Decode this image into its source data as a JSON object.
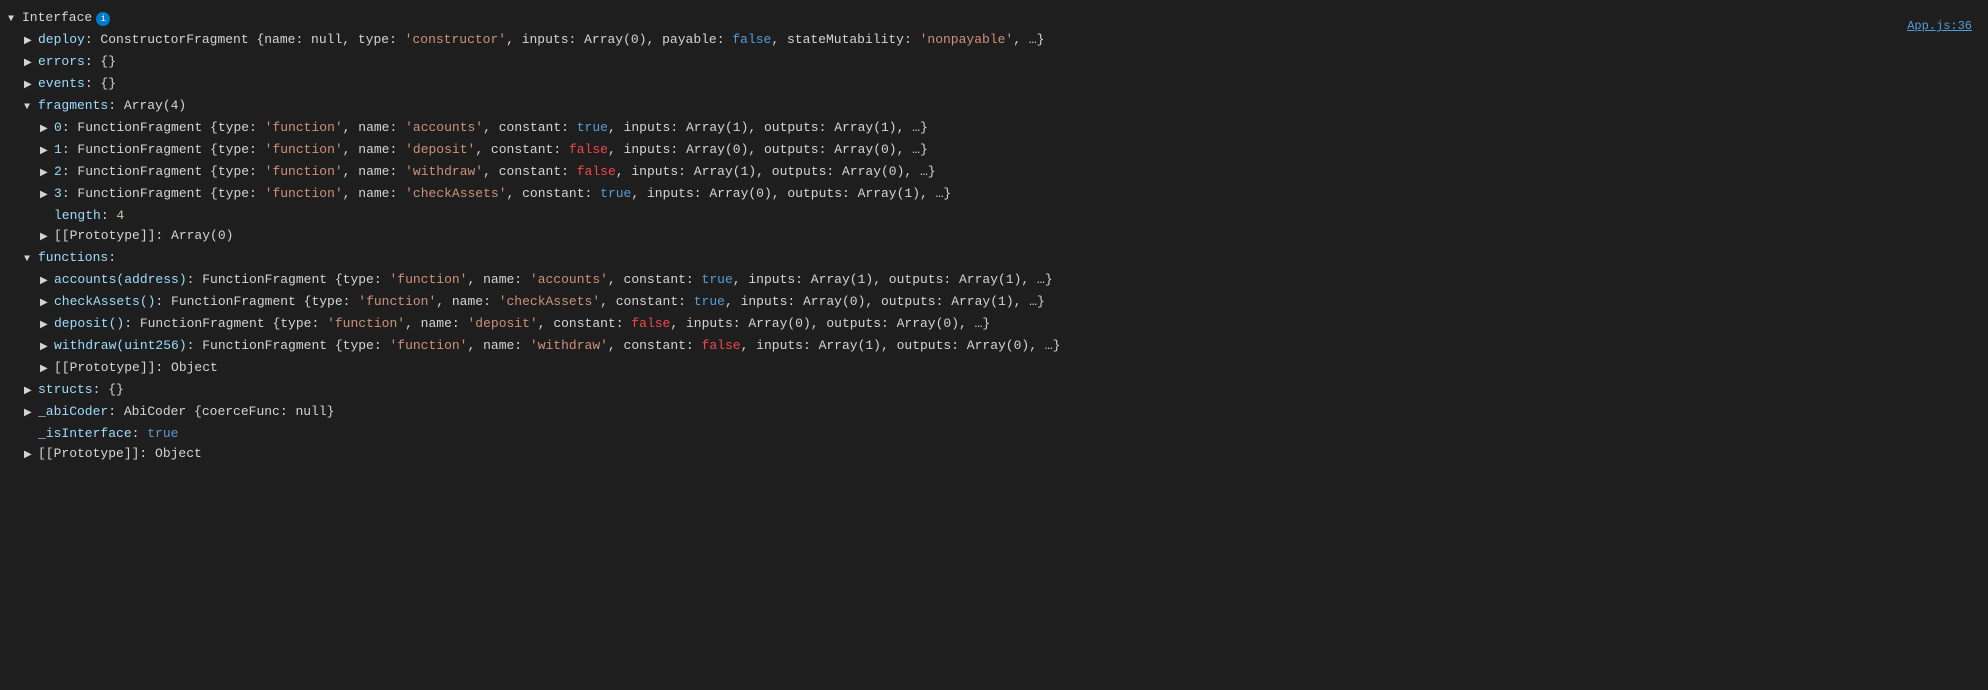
{
  "file_ref": "App.js:36",
  "root": {
    "label": "Interface",
    "badge": "i",
    "expanded": true
  },
  "lines": [
    {
      "indent": 1,
      "type": "collapsed",
      "key": "deploy",
      "value": "ConstructorFragment {name: null, type: ",
      "string1": "'constructor'",
      "value2": ", inputs: Array(0), payable: ",
      "bool1": "false",
      "value3": ", stateMutability: ",
      "string2": "'nonpayable'",
      "value4": ", …}"
    },
    {
      "indent": 1,
      "type": "collapsed",
      "key": "errors",
      "value": "{}"
    },
    {
      "indent": 1,
      "type": "collapsed",
      "key": "events",
      "value": "{}"
    },
    {
      "indent": 1,
      "type": "section-expanded",
      "key": "fragments",
      "value": "Array(4)"
    },
    {
      "indent": 2,
      "type": "collapsed-item",
      "key": "0",
      "value": "FunctionFragment {type: ",
      "string1": "'function'",
      "v2": ", name: ",
      "string2": "'accounts'",
      "v3": ", constant: ",
      "bool1": "true",
      "v4": ", inputs: Array(1), outputs: Array(1), …}"
    },
    {
      "indent": 2,
      "type": "collapsed-item",
      "key": "1",
      "value": "FunctionFragment {type: ",
      "string1": "'function'",
      "v2": ", name: ",
      "string2": "'deposit'",
      "v3": ", constant: ",
      "bool1": "false",
      "v4": ", inputs: Array(0), outputs: Array(0), …}"
    },
    {
      "indent": 2,
      "type": "collapsed-item",
      "key": "2",
      "value": "FunctionFragment {type: ",
      "string1": "'function'",
      "v2": ", name: ",
      "string2": "'withdraw'",
      "v3": ", constant: ",
      "bool1": "false",
      "v4": ", inputs: Array(1), outputs: Array(0), …}"
    },
    {
      "indent": 2,
      "type": "collapsed-item",
      "key": "3",
      "value": "FunctionFragment {type: ",
      "string1": "'function'",
      "v2": ", name: ",
      "string2": "'checkAssets'",
      "v3": ", constant: ",
      "bool1": "true",
      "v4": ", inputs: Array(0), outputs: Array(1), …}"
    },
    {
      "indent": 2,
      "type": "length",
      "key": "length",
      "value": "4"
    },
    {
      "indent": 2,
      "type": "prototype",
      "value": "[[Prototype]]: Array(0)"
    },
    {
      "indent": 1,
      "type": "section-expanded",
      "key": "functions",
      "value": ""
    },
    {
      "indent": 2,
      "type": "collapsed-func",
      "key": "accounts(address)",
      "value": "FunctionFragment {type: ",
      "string1": "'function'",
      "v2": ", name: ",
      "string2": "'accounts'",
      "v3": ", constant: ",
      "bool1": "true",
      "v4": ", inputs: Array(1), outputs: Array(1), …}"
    },
    {
      "indent": 2,
      "type": "collapsed-func",
      "key": "checkAssets()",
      "value": "FunctionFragment {type: ",
      "string1": "'function'",
      "v2": ", name: ",
      "string2": "'checkAssets'",
      "v3": ", constant: ",
      "bool1": "true",
      "v4": ", inputs: Array(0), outputs: Array(1), …}"
    },
    {
      "indent": 2,
      "type": "collapsed-func",
      "key": "deposit()",
      "value": "FunctionFragment {type: ",
      "string1": "'function'",
      "v2": ", name: ",
      "string2": "'deposit'",
      "v3": ", constant: ",
      "bool1": "false",
      "v4": ", inputs: Array(0), outputs: Array(0), …}"
    },
    {
      "indent": 2,
      "type": "collapsed-func",
      "key": "withdraw(uint256)",
      "value": "FunctionFragment {type: ",
      "string1": "'function'",
      "v2": ", name: ",
      "string2": "'withdraw'",
      "v3": ", constant: ",
      "bool1": "false",
      "v4": ", inputs: Array(1), outputs: Array(0), …}"
    },
    {
      "indent": 2,
      "type": "prototype",
      "value": "[[Prototype]]: Object"
    },
    {
      "indent": 1,
      "type": "collapsed",
      "key": "structs",
      "value": "{}"
    },
    {
      "indent": 1,
      "type": "collapsed",
      "key": "_abiCoder",
      "value": "AbiCoder {coerceFunc: null}"
    },
    {
      "indent": 1,
      "type": "bool-prop",
      "key": "_isInterface",
      "value": "true"
    },
    {
      "indent": 1,
      "type": "prototype",
      "value": "[[Prototype]]: Object"
    }
  ]
}
